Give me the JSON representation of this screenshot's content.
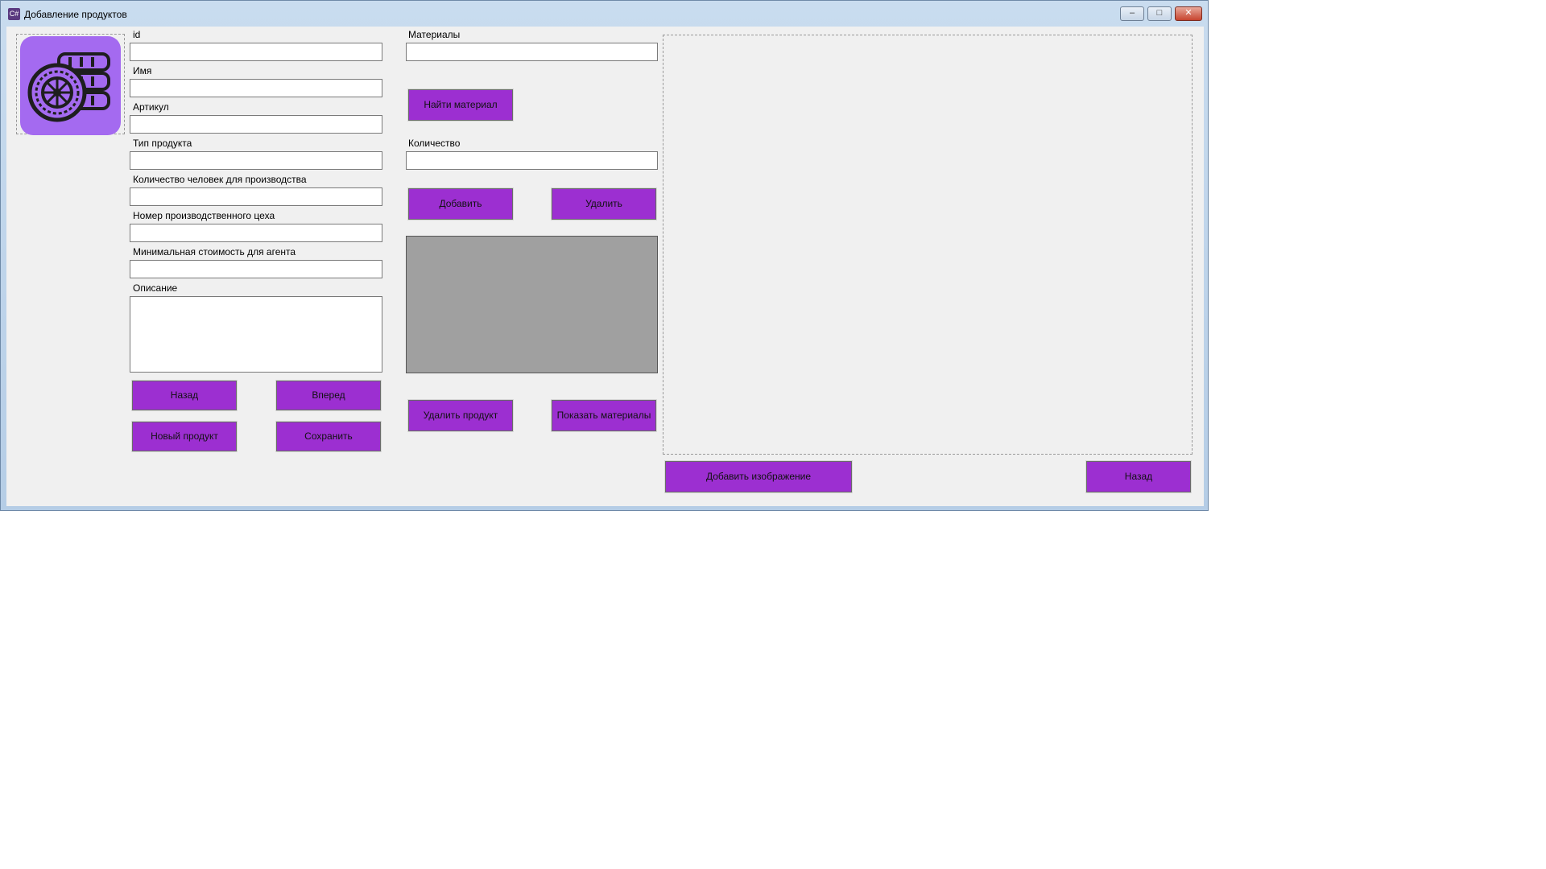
{
  "window": {
    "title": "Добавление продуктов"
  },
  "icons": {
    "app": "app-icon",
    "logo": "tire-wheel-icon",
    "minimize": "minimize-icon",
    "maximize": "maximize-icon",
    "close": "close-icon"
  },
  "colors": {
    "button": "#9c2fd1",
    "logo_bg": "#a46af0",
    "grid": "#a0a0a0"
  },
  "form": {
    "id_label": "id",
    "name_label": "Имя",
    "article_label": "Артикул",
    "type_label": "Тип продукта",
    "people_label": "Количество человек для производства",
    "workshop_label": "Номер производственного цеха",
    "min_cost_label": "Минимальная стоимость для агента",
    "description_label": "Описание"
  },
  "materials": {
    "label": "Материалы",
    "find_button": "Найти материал",
    "quantity_label": "Количество",
    "add_button": "Добавить",
    "delete_button": "Удалить",
    "delete_product_button": "Удалить продукт",
    "show_materials_button": "Показать материалы"
  },
  "nav": {
    "back_button": "Назад",
    "forward_button": "Вперед",
    "new_product_button": "Новый продукт",
    "save_button": "Сохранить"
  },
  "image": {
    "add_image_button": "Добавить изображение",
    "back_button": "Назад"
  }
}
